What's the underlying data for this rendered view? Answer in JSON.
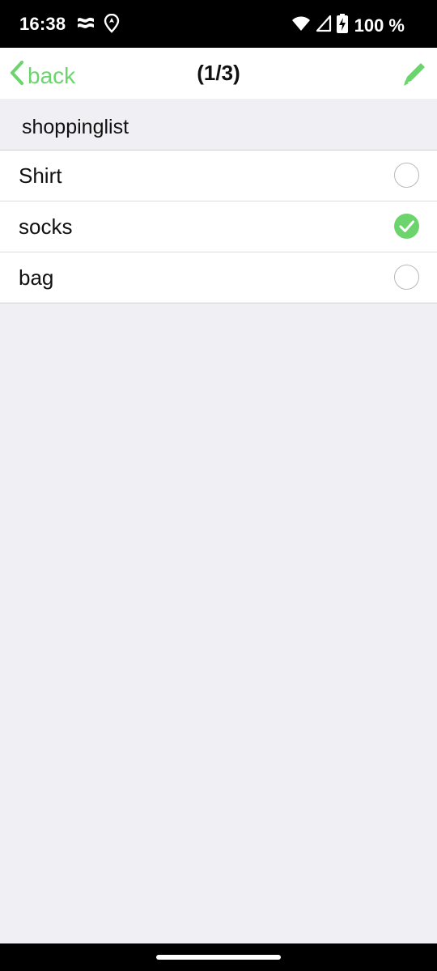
{
  "status_bar": {
    "time": "16:38",
    "left_icons": [
      "flag-icon",
      "location-icon"
    ],
    "right_icons": [
      "wifi-icon",
      "signal-icon",
      "battery-charging-icon"
    ],
    "battery": "100 %"
  },
  "nav": {
    "back_label": "back",
    "title": "(1/3)",
    "edit_icon": "pencil-icon",
    "accent_color": "#6cd46c"
  },
  "list": {
    "name": "shoppinglist",
    "items": [
      {
        "label": "Shirt",
        "checked": false
      },
      {
        "label": "socks",
        "checked": true
      },
      {
        "label": "bag",
        "checked": false
      }
    ]
  }
}
